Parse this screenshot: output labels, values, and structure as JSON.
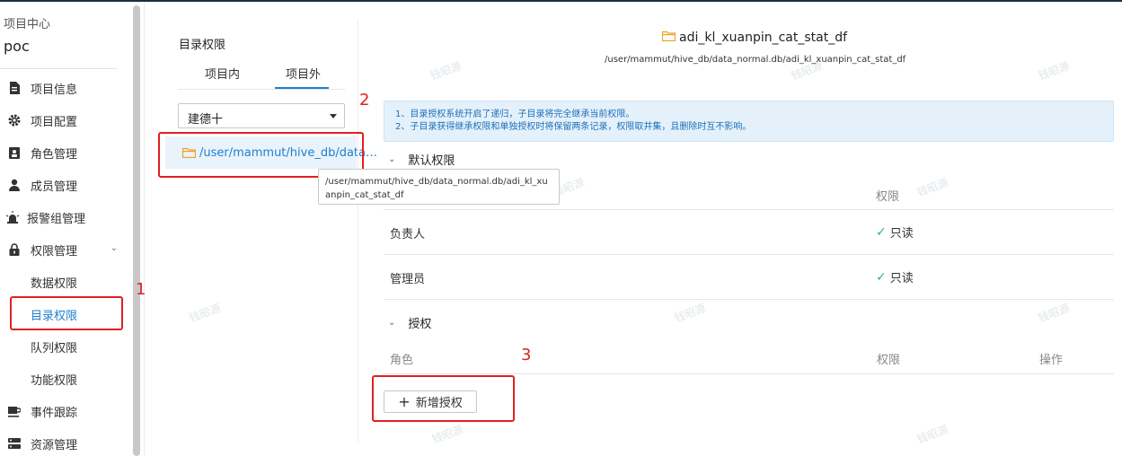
{
  "sidebar": {
    "project_label": "项目中心",
    "project_name": "poc",
    "menu": [
      {
        "label": "项目信息",
        "icon": "document-icon"
      },
      {
        "label": "项目配置",
        "icon": "gear-icon"
      },
      {
        "label": "角色管理",
        "icon": "badge-icon"
      },
      {
        "label": "成员管理",
        "icon": "user-icon"
      },
      {
        "label": "报警组管理",
        "icon": "alarm-icon"
      },
      {
        "label": "权限管理",
        "icon": "lock-icon"
      }
    ],
    "permission_sub": [
      {
        "label": "数据权限"
      },
      {
        "label": "目录权限"
      },
      {
        "label": "队列权限"
      },
      {
        "label": "功能权限"
      }
    ],
    "menu_bottom": [
      {
        "label": "事件跟踪",
        "icon": "cup-icon"
      },
      {
        "label": "资源管理",
        "icon": "server-icon"
      }
    ]
  },
  "annotations": {
    "n1": "1",
    "n2": "2",
    "n3": "3"
  },
  "tree": {
    "title": "目录权限",
    "tabs": [
      "项目内",
      "项目外"
    ],
    "active_tab": "项目外",
    "select_value": "建德十",
    "node_label": "/user/mammut/hive_db/data…",
    "tooltip": "/user/mammut/hive_db/data_normal.db/adi_kl_xuanpin_cat_stat_df"
  },
  "detail": {
    "title": "adi_kl_xuanpin_cat_stat_df",
    "path": "/user/mammut/hive_db/data_normal.db/adi_kl_xuanpin_cat_stat_df",
    "notice_line1": "1、目录授权系统开启了递归，子目录将完全继承当前权限。",
    "notice_line2": "2、子目录获得继承权限和单独授权时将保留两条记录，权限取并集，且删除时互不影响。",
    "default_section": {
      "label": "默认权限",
      "perm_header": "权限",
      "rows": [
        {
          "role": "负责人",
          "perm": "只读"
        },
        {
          "role": "管理员",
          "perm": "只读"
        }
      ]
    },
    "grant_section": {
      "label": "授权",
      "col_role": "角色",
      "col_perm": "权限",
      "col_op": "操作"
    },
    "add_button": "新增授权"
  },
  "watermark": "钱昭源",
  "colors": {
    "accent": "#1e7fcf",
    "highlight_red": "#e02020",
    "check_green": "#34b27d",
    "notice_bg": "#e4f1fb"
  }
}
